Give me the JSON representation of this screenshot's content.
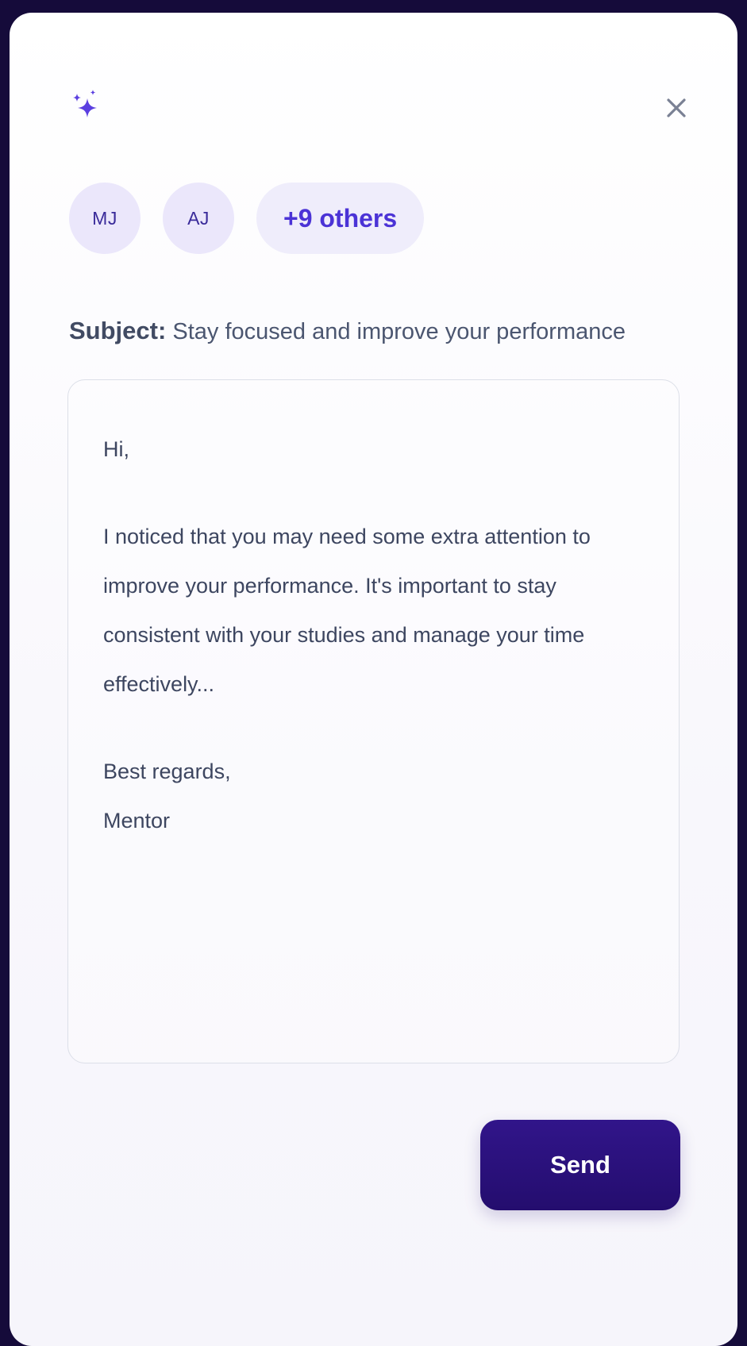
{
  "icons": {
    "sparkle": "sparkle-icon",
    "close": "close-icon"
  },
  "recipients": {
    "avatars": [
      "MJ",
      "AJ"
    ],
    "others_label": "+9 others"
  },
  "subject": {
    "label": "Subject:",
    "value": "Stay focused and improve your performance"
  },
  "message": {
    "greeting": "Hi,",
    "paragraph_lines": [
      "I noticed that you may need some extra attention to",
      "improve your performance. It's important to stay",
      "consistent with your studies and manage your time",
      "effectively..."
    ],
    "closing": "Best regards,",
    "signature": "Mentor"
  },
  "actions": {
    "send_label": "Send"
  },
  "colors": {
    "accent": "#4b33d6",
    "button": "#2a1178",
    "backdrop": "#150b3a"
  }
}
